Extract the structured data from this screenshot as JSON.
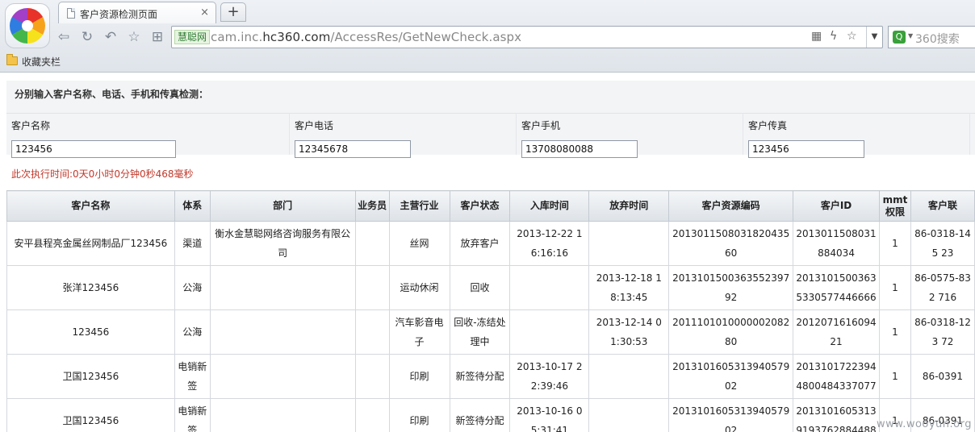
{
  "browser": {
    "tab_title": "客户资源检测页面",
    "tab_close": "×",
    "new_tab": "+",
    "site_badge": "慧聪网",
    "url_prefix": "cam.inc.",
    "url_host": "hc360.com",
    "url_path": "/AccessRes/GetNewCheck.aspx",
    "search_placeholder": "360搜索",
    "search_engine_glyph": "Q",
    "favorites_label": "收藏夹栏"
  },
  "form": {
    "heading": "分别输入客户名称、电话、手机和传真检测：",
    "fields": [
      {
        "label": "客户名称",
        "value": "123456"
      },
      {
        "label": "客户电话",
        "value": "12345678"
      },
      {
        "label": "客户手机",
        "value": "13708080088"
      },
      {
        "label": "客户传真",
        "value": "123456"
      }
    ]
  },
  "exec_time": "此次执行时间:0天0小时0分钟0秒468毫秒",
  "table": {
    "headers": [
      "客户名称",
      "体系",
      "部门",
      "业务员",
      "主营行业",
      "客户状态",
      "入库时间",
      "放弃时间",
      "客户资源编码",
      "客户ID",
      "mmt权限",
      "客户联"
    ],
    "rows": [
      [
        "安平县程亮金属丝网制品厂123456",
        "渠道",
        "衡水金慧聪网络咨询服务有限公司",
        "",
        "丝网",
        "放弃客户",
        "2013-12-22 16:16:16",
        "",
        "20130115080318204356​0",
        "2013011508031884034",
        "1",
        "86-0318-145 23"
      ],
      [
        "张洋123456",
        "公海",
        "",
        "",
        "运动休闲",
        "回收",
        "",
        "2013-12-18 18:13:45",
        "201310150036355239792",
        "20131015003635330577446666",
        "1",
        "86-0575-832 716"
      ],
      [
        "123456",
        "公海",
        "",
        "",
        "汽车影音电子",
        "回收-冻结处理中",
        "",
        "2013-12-14 01:30:53",
        "201110101000000208280",
        "201207161609421",
        "1",
        "86-0318-123 72"
      ],
      [
        "卫国123456",
        "电销新签",
        "",
        "",
        "印刷",
        "新签待分配",
        "2013-10-17 22:39:46",
        "",
        "201310160531394057902",
        "20131017223944800484337077",
        "1",
        "86-0391"
      ],
      [
        "卫国123456",
        "电销新签",
        "",
        "",
        "印刷",
        "新签待分配",
        "2013-10-16 05:31:41",
        "",
        "201310160531394057902",
        "20131016053139193762884488",
        "1",
        "86-0391"
      ]
    ]
  },
  "watermark": "www.wooyun.org"
}
